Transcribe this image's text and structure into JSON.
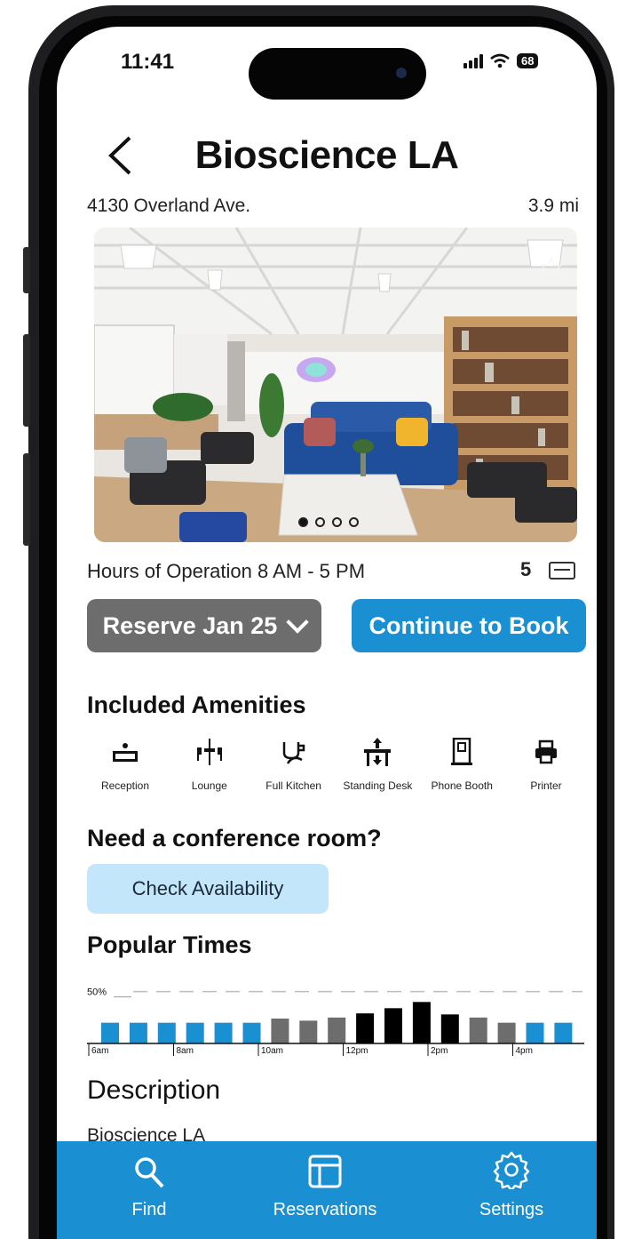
{
  "status_bar": {
    "time": "11:41",
    "battery": "68"
  },
  "header": {
    "title": "Bioscience LA",
    "address": "4130 Overland Ave.",
    "distance": "3.9 mi"
  },
  "photo": {
    "alt": "Open office lounge with blue sofas and bookshelves",
    "dots_total": 4,
    "dots_active": 1
  },
  "info": {
    "hours": "Hours of Operation 8 AM - 5 PM",
    "desk_count": "5"
  },
  "actions": {
    "reserve_label": "Reserve Jan 25",
    "continue_label": "Continue to Book"
  },
  "amenities": {
    "heading": "Included Amenities",
    "items": [
      {
        "label": "Reception",
        "icon": "reception-icon"
      },
      {
        "label": "Lounge",
        "icon": "lounge-icon"
      },
      {
        "label": "Full Kitchen",
        "icon": "kitchen-icon"
      },
      {
        "label": "Standing Desk",
        "icon": "standing-desk-icon"
      },
      {
        "label": "Phone Booth",
        "icon": "phone-booth-icon"
      },
      {
        "label": "Printer",
        "icon": "printer-icon"
      }
    ]
  },
  "conference": {
    "heading": "Need a conference room?",
    "button_label": "Check Availability"
  },
  "popular_times": {
    "heading": "Popular Times",
    "colors": {
      "low": "#1a8fd1",
      "medium": "#6d6d6d",
      "high": "#000000"
    }
  },
  "chart_data": {
    "type": "bar",
    "title": "",
    "y_reference_label": "50%",
    "ylim": [
      0,
      60
    ],
    "reference_line": 50,
    "tick_labels": [
      "6am",
      "8am",
      "10am",
      "12pm",
      "2pm",
      "4pm"
    ],
    "values": [
      20,
      20,
      20,
      20,
      20,
      20,
      24,
      22,
      25,
      29,
      34,
      40,
      28,
      25,
      20,
      20,
      20
    ],
    "levels": [
      "low",
      "low",
      "low",
      "low",
      "low",
      "low",
      "medium",
      "medium",
      "medium",
      "high",
      "high",
      "high",
      "high",
      "medium",
      "medium",
      "low",
      "low"
    ]
  },
  "description": {
    "heading": "Description",
    "text": "Bioscience LA"
  },
  "tabbar": {
    "items": [
      {
        "label": "Find",
        "icon": "search-icon"
      },
      {
        "label": "Reservations",
        "icon": "layout-icon"
      },
      {
        "label": "Settings",
        "icon": "gear-icon"
      }
    ]
  }
}
